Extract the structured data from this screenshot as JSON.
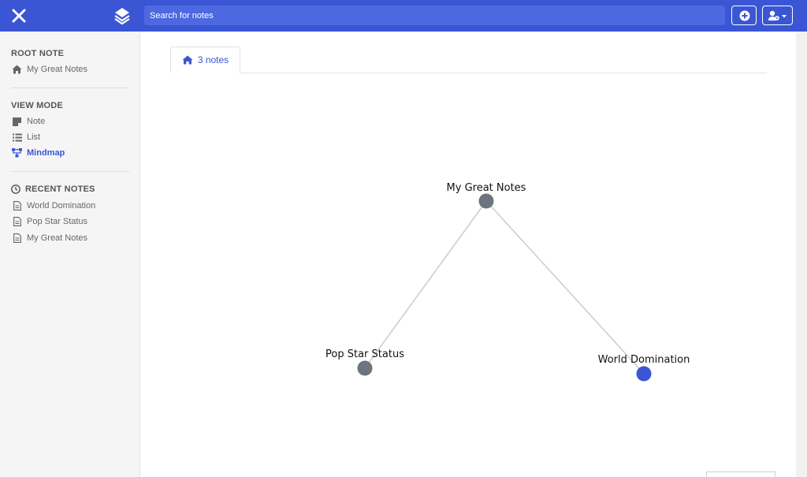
{
  "header": {
    "search_placeholder": "Search for notes",
    "accent": "#3a56d4"
  },
  "sidebar": {
    "root_title": "ROOT NOTE",
    "root_item": "My Great Notes",
    "view_title": "VIEW MODE",
    "view_items": [
      "Note",
      "List",
      "Mindmap"
    ],
    "active_view": "Mindmap",
    "recent_title": "RECENT NOTES",
    "recent_items": [
      "World Domination",
      "Pop Star Status",
      "My Great Notes"
    ]
  },
  "tab": {
    "label": "3 notes",
    "icon": "home-icon"
  },
  "mindmap": {
    "root": {
      "label": "My Great Notes",
      "color": "#6c757d"
    },
    "children": [
      {
        "label": "Pop Star Status",
        "color": "#6c757d"
      },
      {
        "label": "World Domination",
        "color": "#3a56d4",
        "selected": true
      }
    ],
    "edge_color": "#cccccc"
  }
}
